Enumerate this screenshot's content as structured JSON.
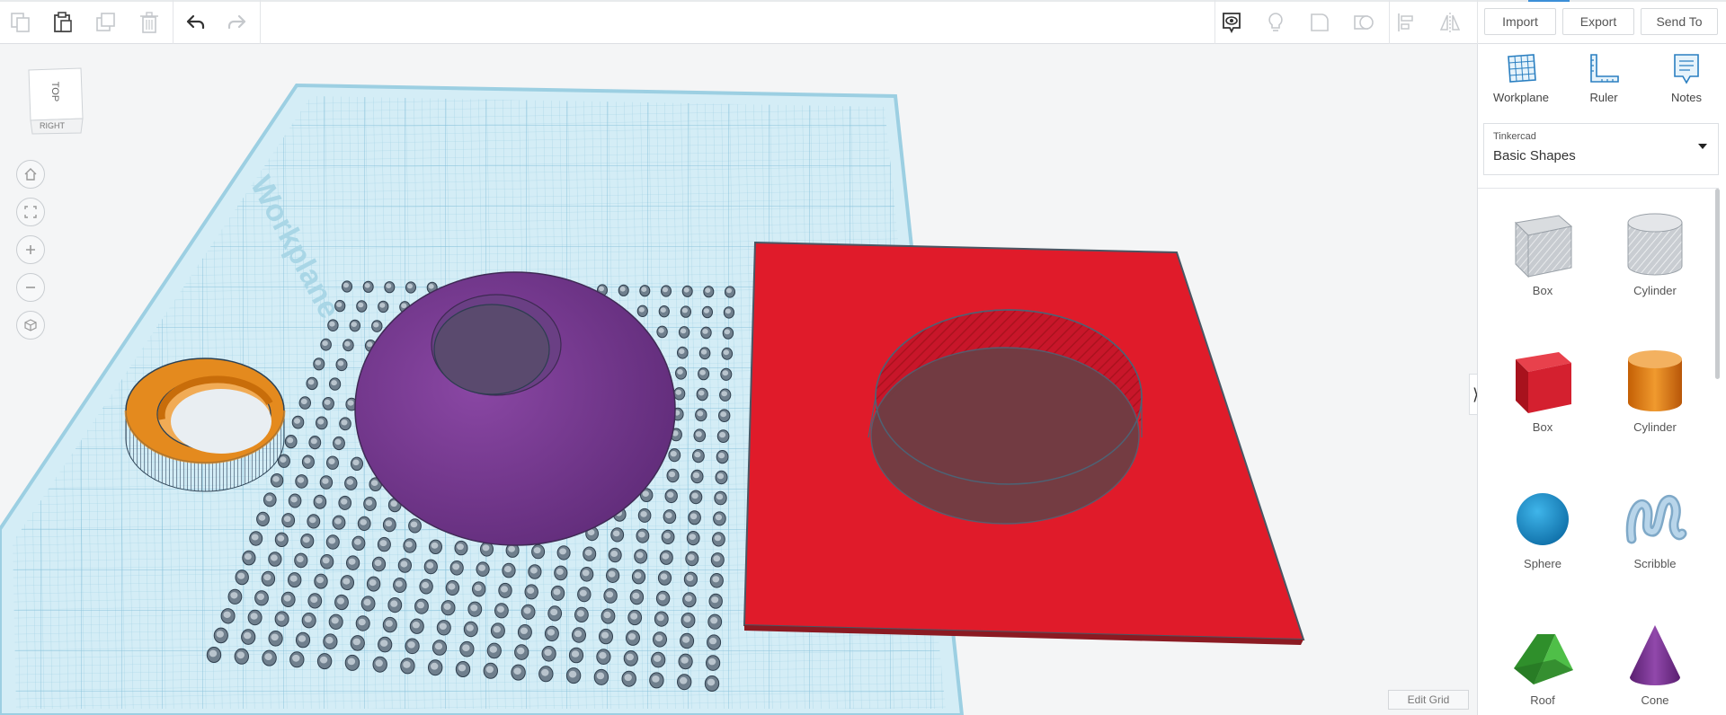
{
  "toolbar": {
    "icons": [
      "copy-icon",
      "paste-icon",
      "duplicate-icon",
      "delete-icon",
      "undo-icon",
      "redo-icon",
      "notes-visibility-icon",
      "light-icon",
      "shape-icon",
      "group-icon",
      "align-icon",
      "mirror-icon"
    ],
    "import_label": "Import",
    "export_label": "Export",
    "send_to_label": "Send To",
    "accent_color": "#3c8fd8"
  },
  "viewcube": {
    "top_label": "TOP",
    "right_label": "RIGHT"
  },
  "nav": [
    "home-icon",
    "fit-view-icon",
    "zoom-in-icon",
    "zoom-out-icon",
    "perspective-icon"
  ],
  "workplane": {
    "label": "Workplane",
    "color": "#cde9f3"
  },
  "edit_grid_label": "Edit Grid",
  "panel": {
    "tools": [
      {
        "label": "Workplane",
        "icon": "workplane-icon"
      },
      {
        "label": "Ruler",
        "icon": "ruler-icon"
      },
      {
        "label": "Notes",
        "icon": "notes-icon"
      }
    ],
    "library": {
      "brand": "Tinkercad",
      "selected": "Basic Shapes"
    },
    "shapes": [
      {
        "label": "Box",
        "icon": "box-hole-icon",
        "color": "#b8bcc2"
      },
      {
        "label": "Cylinder",
        "icon": "cylinder-hole-icon",
        "color": "#c2c6cb"
      },
      {
        "label": "Box",
        "icon": "box-icon",
        "color": "#d4202f"
      },
      {
        "label": "Cylinder",
        "icon": "cylinder-icon",
        "color": "#e07a12"
      },
      {
        "label": "Sphere",
        "icon": "sphere-icon",
        "color": "#1a8fcf"
      },
      {
        "label": "Scribble",
        "icon": "scribble-icon",
        "color": "#9ec3dd"
      },
      {
        "label": "Roof",
        "icon": "roof-icon",
        "color": "#3fa63a"
      },
      {
        "label": "Cone",
        "icon": "cone-icon",
        "color": "#7b2f8f"
      }
    ]
  },
  "scene_objects": {
    "ring": {
      "name": "orange-ring",
      "color": "#e48a1e"
    },
    "dome": {
      "name": "purple-dome",
      "color": "#7a3a92"
    },
    "plate": {
      "name": "red-plate",
      "color": "#e01b2a"
    }
  }
}
